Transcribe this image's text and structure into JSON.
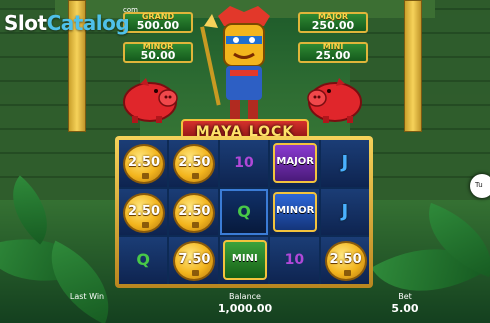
{
  "branding": {
    "logo_slot": "Slot",
    "logo_catalog": "Catalog",
    "logo_com": "com"
  },
  "jackpots": {
    "grand": {
      "label": "GRAND",
      "value": "500.00"
    },
    "minor": {
      "label": "MINOR",
      "value": "50.00"
    },
    "major": {
      "label": "MAJOR",
      "value": "250.00"
    },
    "mini": {
      "label": "MINI",
      "value": "25.00"
    }
  },
  "game": {
    "title": "MAYA LOCK"
  },
  "reels": [
    [
      {
        "type": "coin",
        "value": "2.50"
      },
      {
        "type": "coin",
        "value": "2.50"
      },
      {
        "type": "symbol",
        "value": "10"
      },
      {
        "type": "jackpot",
        "value": "MAJOR"
      },
      {
        "type": "symbol",
        "value": "J"
      }
    ],
    [
      {
        "type": "coin",
        "value": "2.50"
      },
      {
        "type": "coin",
        "value": "2.50"
      },
      {
        "type": "symbol",
        "value": "Q"
      },
      {
        "type": "jackpot",
        "value": "MINOR"
      },
      {
        "type": "symbol",
        "value": "J"
      }
    ],
    [
      {
        "type": "symbol",
        "value": "Q"
      },
      {
        "type": "coin",
        "value": "7.50"
      },
      {
        "type": "jackpot",
        "value": "MINI"
      },
      {
        "type": "symbol",
        "value": "10"
      },
      {
        "type": "coin",
        "value": "2.50"
      }
    ]
  ],
  "status": {
    "last_win_label": "Last Win",
    "balance_label": "Balance",
    "balance_value": "1,000.00",
    "bet_label": "Bet",
    "bet_value": "5.00"
  },
  "turbo": {
    "label": "Tu"
  },
  "colors": {
    "gold": "#f3c33d",
    "reel_bg": "#0d2a55",
    "jungle": "#2f6e33"
  }
}
